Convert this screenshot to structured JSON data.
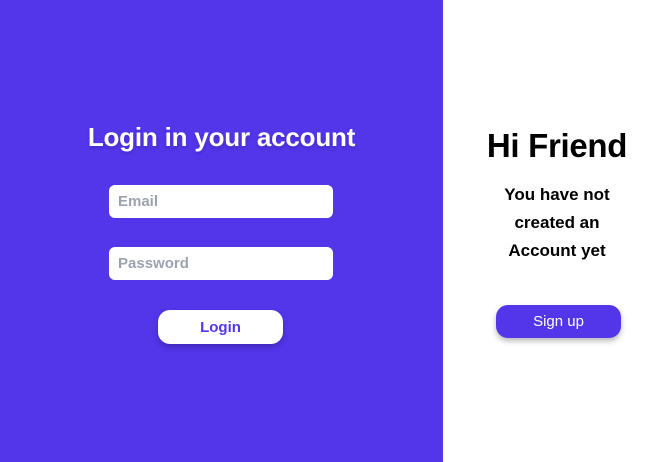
{
  "login": {
    "title": "Login in your account",
    "email_placeholder": "Email",
    "email_value": "",
    "password_placeholder": "Password",
    "password_value": "",
    "button_label": "Login"
  },
  "signup": {
    "greeting": "Hi Friend",
    "message": "You have not created an Account yet",
    "button_label": "Sign up"
  },
  "colors": {
    "accent": "#5335ea",
    "panel_background": "#ffffff",
    "placeholder_text": "#9ca3af"
  }
}
